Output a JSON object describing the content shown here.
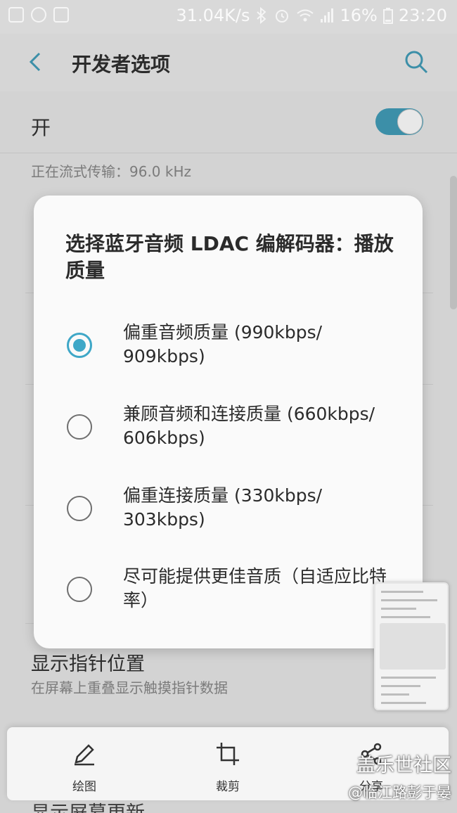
{
  "status_bar": {
    "speed": "31.04K/s",
    "battery": "16%",
    "time": "23:20",
    "icons": [
      "image-icon",
      "spinner-icon",
      "cloud-app-icon",
      "bluetooth-icon",
      "alarm-icon",
      "wifi-icon",
      "signal-icon",
      "battery-icon"
    ]
  },
  "header": {
    "title": "开发者选项"
  },
  "background": {
    "master_label": "开",
    "master_on": true,
    "streaming_text": "正在流式传输：96.0 kHz",
    "pointer_title": "显示指针位置",
    "pointer_sub": "在屏幕上重叠显示触摸指针数据",
    "bottom_partial": "显示屏幕更新"
  },
  "dialog": {
    "title": "选择蓝牙音频 LDAC 编解码器：播放质量",
    "options": [
      {
        "label": "偏重音频质量 (990kbps/ 909kbps)",
        "checked": true
      },
      {
        "label": "兼顾音频和连接质量 (660kbps/ 606kbps)",
        "checked": false
      },
      {
        "label": "偏重连接质量 (330kbps/ 303kbps)",
        "checked": false
      },
      {
        "label": "尽可能提供更佳音质（自适应比特率）",
        "checked": false
      }
    ]
  },
  "toolbar": {
    "draw_label": "绘图",
    "crop_label": "裁剪",
    "share_label": "分享"
  },
  "watermark": {
    "line1": "盖乐世社区",
    "line2": "@临江路彭于晏"
  },
  "colors": {
    "accent": "#3ea7c7",
    "toggle": "#3c8fa8",
    "dialog_bg": "#fafafa",
    "scrim_bg": "#d3d3d3"
  }
}
